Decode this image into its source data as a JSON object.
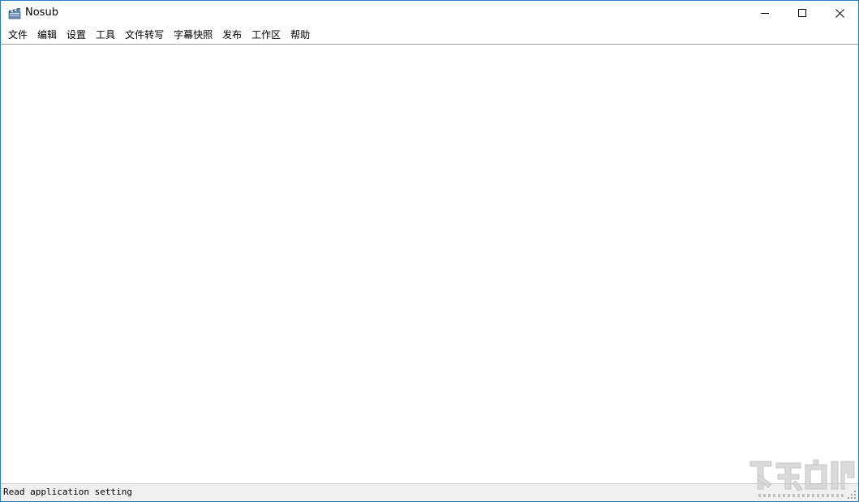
{
  "window": {
    "title": "Nosub"
  },
  "menu": {
    "items": [
      "文件",
      "编辑",
      "设置",
      "工具",
      "文件转写",
      "字幕快照",
      "发布",
      "工作区",
      "帮助"
    ]
  },
  "status": {
    "text": "Read application setting"
  },
  "colors": {
    "window_border": "#2b7bc4",
    "statusbar_bg": "#f0f0f0",
    "content_bg": "#ffffff"
  },
  "icons": {
    "app": "clapperboard-icon",
    "minimize": "minimize-icon",
    "maximize": "maximize-icon",
    "close": "close-icon"
  }
}
